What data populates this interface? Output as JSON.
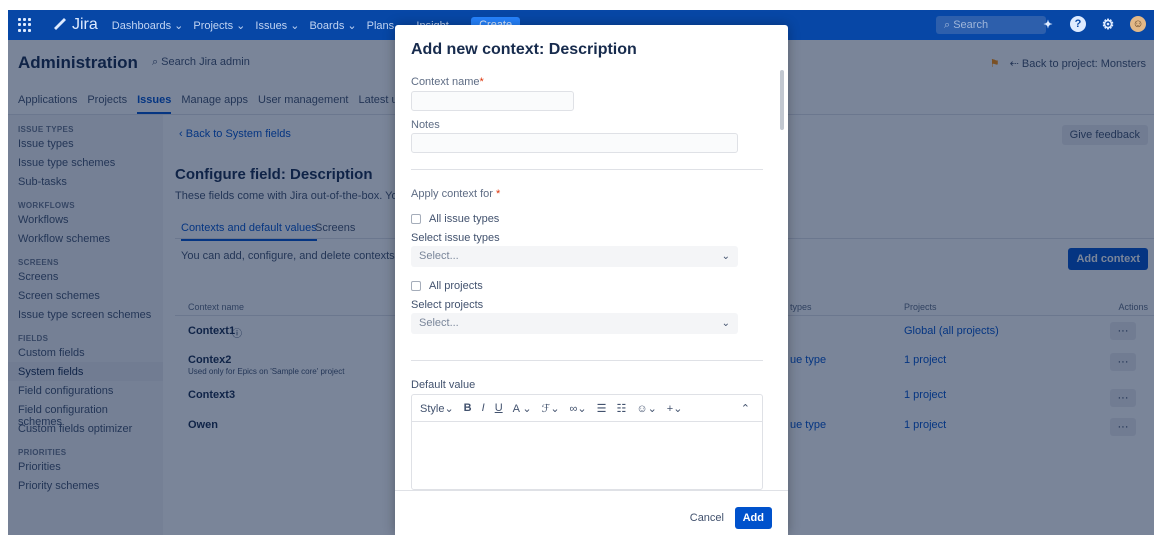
{
  "topnav": {
    "logo": "Jira",
    "items": [
      "Dashboards ⌄",
      "Projects ⌄",
      "Issues ⌄",
      "Boards ⌄",
      "Plans ⌄",
      "Insight ⌄"
    ],
    "create": "Create",
    "search_placeholder": "Search"
  },
  "admin": {
    "title": "Administration",
    "search": "Search Jira admin",
    "back": "Back to project: Monsters"
  },
  "tabs": [
    "Applications",
    "Projects",
    "Issues",
    "Manage apps",
    "User management",
    "Latest upgrade"
  ],
  "sidebar": {
    "sections": [
      {
        "head": "ISSUE TYPES",
        "items": [
          "Issue types",
          "Issue type schemes",
          "Sub-tasks"
        ]
      },
      {
        "head": "WORKFLOWS",
        "items": [
          "Workflows",
          "Workflow schemes"
        ]
      },
      {
        "head": "SCREENS",
        "items": [
          "Screens",
          "Screen schemes",
          "Issue type screen schemes"
        ]
      },
      {
        "head": "FIELDS",
        "items": [
          "Custom fields",
          "System fields",
          "Field configurations",
          "Field configuration schemes",
          "Custom fields optimizer"
        ]
      },
      {
        "head": "PRIORITIES",
        "items": [
          "Priorities",
          "Priority schemes"
        ]
      }
    ]
  },
  "main": {
    "back": "Back to System fields",
    "feedback": "Give feedback",
    "title": "Configure field: Description",
    "desc": "These fields come with Jira out-of-the-box. You can",
    "tab1": "Contexts and default values",
    "tab2": "Screens",
    "info": "You can add, configure, and delete contexts deper",
    "add_context": "Add context",
    "columns": {
      "name": "Context name",
      "types": "types",
      "projects": "Projects",
      "actions": "Actions"
    },
    "rows": [
      {
        "name": "Context1",
        "sub": "",
        "types": "",
        "projects": "Global (all projects)"
      },
      {
        "name": "Contex2",
        "sub": "Used only for Epics on 'Sample core' project",
        "types": "ue type",
        "projects": "1 project"
      },
      {
        "name": "Context3",
        "sub": "",
        "types": "",
        "projects": "1 project"
      },
      {
        "name": "Owen",
        "sub": "",
        "types": "ue type",
        "projects": "1 project"
      }
    ],
    "more": "···"
  },
  "modal": {
    "title": "Add new context: Description",
    "context_name_label": "Context name",
    "notes_label": "Notes",
    "apply_label": "Apply context for",
    "all_issue_types": "All issue types",
    "select_issue_types_label": "Select issue types",
    "select_placeholder": "Select...",
    "all_projects": "All projects",
    "select_projects_label": "Select projects",
    "default_value_label": "Default value",
    "toolbar": {
      "style": "Style⌄",
      "bold": "B",
      "italic": "I",
      "underline": "U",
      "color": "A ⌄",
      "more": "⌄",
      "link": "⌄",
      "emoji": "⌄",
      "plus": "+⌄",
      "collapse": "⌃"
    },
    "cancel": "Cancel",
    "add": "Add"
  }
}
